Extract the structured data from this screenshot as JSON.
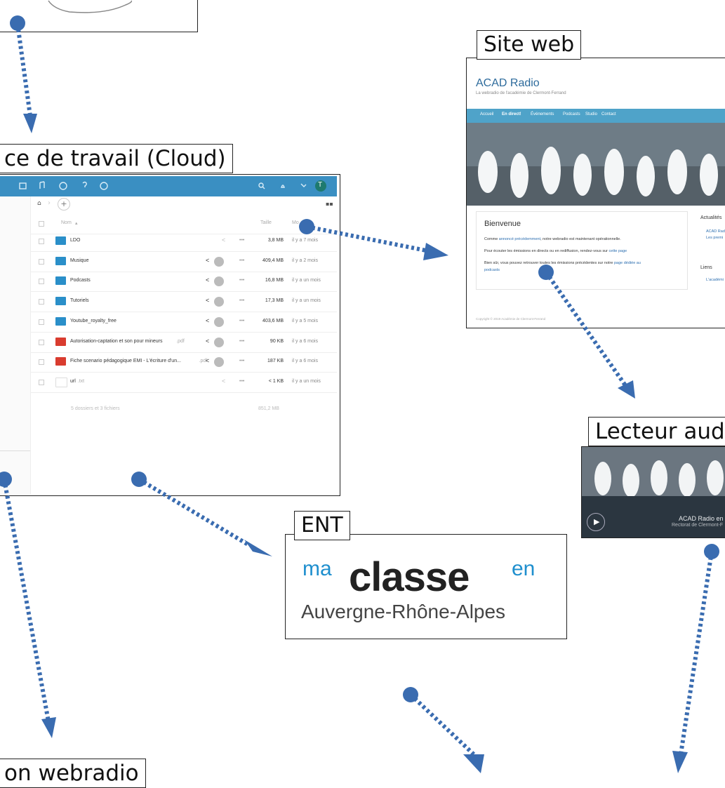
{
  "labels": {
    "workspace": "ce de travail (Cloud)",
    "site": "Site web",
    "player": "Lecteur aud",
    "ent": "ENT",
    "emission": "on webradio"
  },
  "cloud": {
    "avatar_letter": "T",
    "header_name": "Nom",
    "header_size": "Taille",
    "header_mod": "Mo",
    "rows": [
      {
        "name": "LDO",
        "ext": "",
        "size": "3,8 MB",
        "date": "il y a 7 mois",
        "type": "folder"
      },
      {
        "name": "Musique",
        "ext": "",
        "size": "409,4 MB",
        "date": "il y a 2 mois",
        "type": "shared"
      },
      {
        "name": "Podcasts",
        "ext": "",
        "size": "16,8 MB",
        "date": "il y a un mois",
        "type": "shared"
      },
      {
        "name": "Tutoriels",
        "ext": "",
        "size": "17,3 MB",
        "date": "il y a un mois",
        "type": "shared"
      },
      {
        "name": "Youtube_royalty_free",
        "ext": "",
        "size": "403,6 MB",
        "date": "il y a 5 mois",
        "type": "shared"
      },
      {
        "name": "Autorisation-captation et son pour mineurs",
        "ext": ".pdf",
        "size": "90 KB",
        "date": "il y a 6 mois",
        "type": "pdf"
      },
      {
        "name": "Fiche scenario pédagogique EMI - L'écriture d'un...",
        "ext": ".pdf",
        "size": "187 KB",
        "date": "il y a 6 mois",
        "type": "pdf"
      },
      {
        "name": "url",
        "ext": ".txt",
        "size": "< 1 KB",
        "date": "il y a un mois",
        "type": "txt"
      }
    ],
    "summary": "5 dossiers et 3 fichiers",
    "total": "851,2 MB"
  },
  "site": {
    "title": "ACAD Radio",
    "subtitle": "La webradio de l'académie de Clermont-Ferrand",
    "nav": [
      "Accueil",
      "En direct!",
      "Événements",
      "Podcasts",
      "Studio",
      "Contact"
    ],
    "welcome_title": "Bienvenue",
    "p1_a": "Comme ",
    "p1_link": "annoncé précédemment",
    "p1_b": ", notre webradio est maintenant opérationnelle.",
    "p2_a": "Pour écouter les émissions en directs ou en rediffusion, rendez-vous sur ",
    "p2_link": "cette page",
    "p3_a": "Bien sûr, vous pouvez retrouver toutes les émissions précédentes sur notre ",
    "p3_link": "page dédiée au",
    "p3_link2": "podcasts",
    "news_title": "Actualités",
    "news1": "ACAD Rad",
    "news2": "Les premi",
    "links_title": "Liens",
    "link1": "L'académi",
    "copyright": "Copyright © 2019 Académie de Clermont-Ferrand"
  },
  "player": {
    "line1": "ACAD Radio en",
    "line2": "Rectorat de Clermont-F"
  },
  "ent": {
    "ma": "ma",
    "classe": "classe",
    "en": "en",
    "region": "Auvergne-Rhône-Alpes"
  },
  "colors": {
    "arrow": "#3a6cb0",
    "cloud_bar": "#3a8fc2",
    "site_nav": "#4fa3c9",
    "player_bg": "#2b3640",
    "ent_blue": "#1f8fce"
  }
}
